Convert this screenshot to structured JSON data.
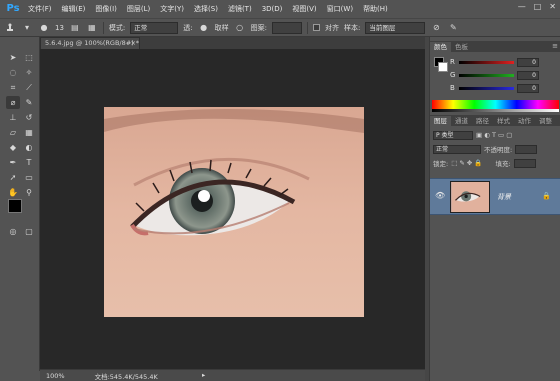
{
  "app": {
    "logo": "Ps"
  },
  "menu": [
    "文件(F)",
    "编辑(E)",
    "图像(I)",
    "图层(L)",
    "文字(Y)",
    "选择(S)",
    "滤镜(T)",
    "3D(D)",
    "视图(V)",
    "窗口(W)",
    "帮助(H)"
  ],
  "window_controls": {
    "minimize": "—",
    "maximize": "□",
    "close": "✕"
  },
  "options": {
    "brush_size": "13",
    "mode_label": "模式:",
    "mode_value": "正常",
    "opacity_label": "透:",
    "source_label": "取样",
    "pattern_label": "图案:",
    "align_label": "对齐",
    "sample_label": "样本:",
    "sample_value": "当前图层"
  },
  "document": {
    "tab_title": "5.6.4.jpg @ 100%(RGB/8#) *",
    "tab_close": "×"
  },
  "status": {
    "zoom": "100%",
    "doc_info": "文档:545.4K/545.4K",
    "arrow": "▸"
  },
  "color_panel": {
    "tabs": [
      "颜色",
      "色板"
    ],
    "channels": [
      {
        "name": "R",
        "value": "0",
        "color": "#d21f1f"
      },
      {
        "name": "G",
        "value": "0",
        "color": "#1fa21f"
      },
      {
        "name": "B",
        "value": "0",
        "color": "#2a2ad0"
      }
    ]
  },
  "layers_panel": {
    "tabs": [
      "图层",
      "通道",
      "路径",
      "样式",
      "动作",
      "调整"
    ],
    "filter_label": "P 类型",
    "blend_mode": "正常",
    "opacity_label": "不透明度:",
    "lock_label": "锁定:",
    "fill_label": "填充:",
    "layer_name": "背景"
  },
  "colors": {
    "foreground": "#000000",
    "background": "#ffffff",
    "selected_layer": "#5f7a9a"
  }
}
